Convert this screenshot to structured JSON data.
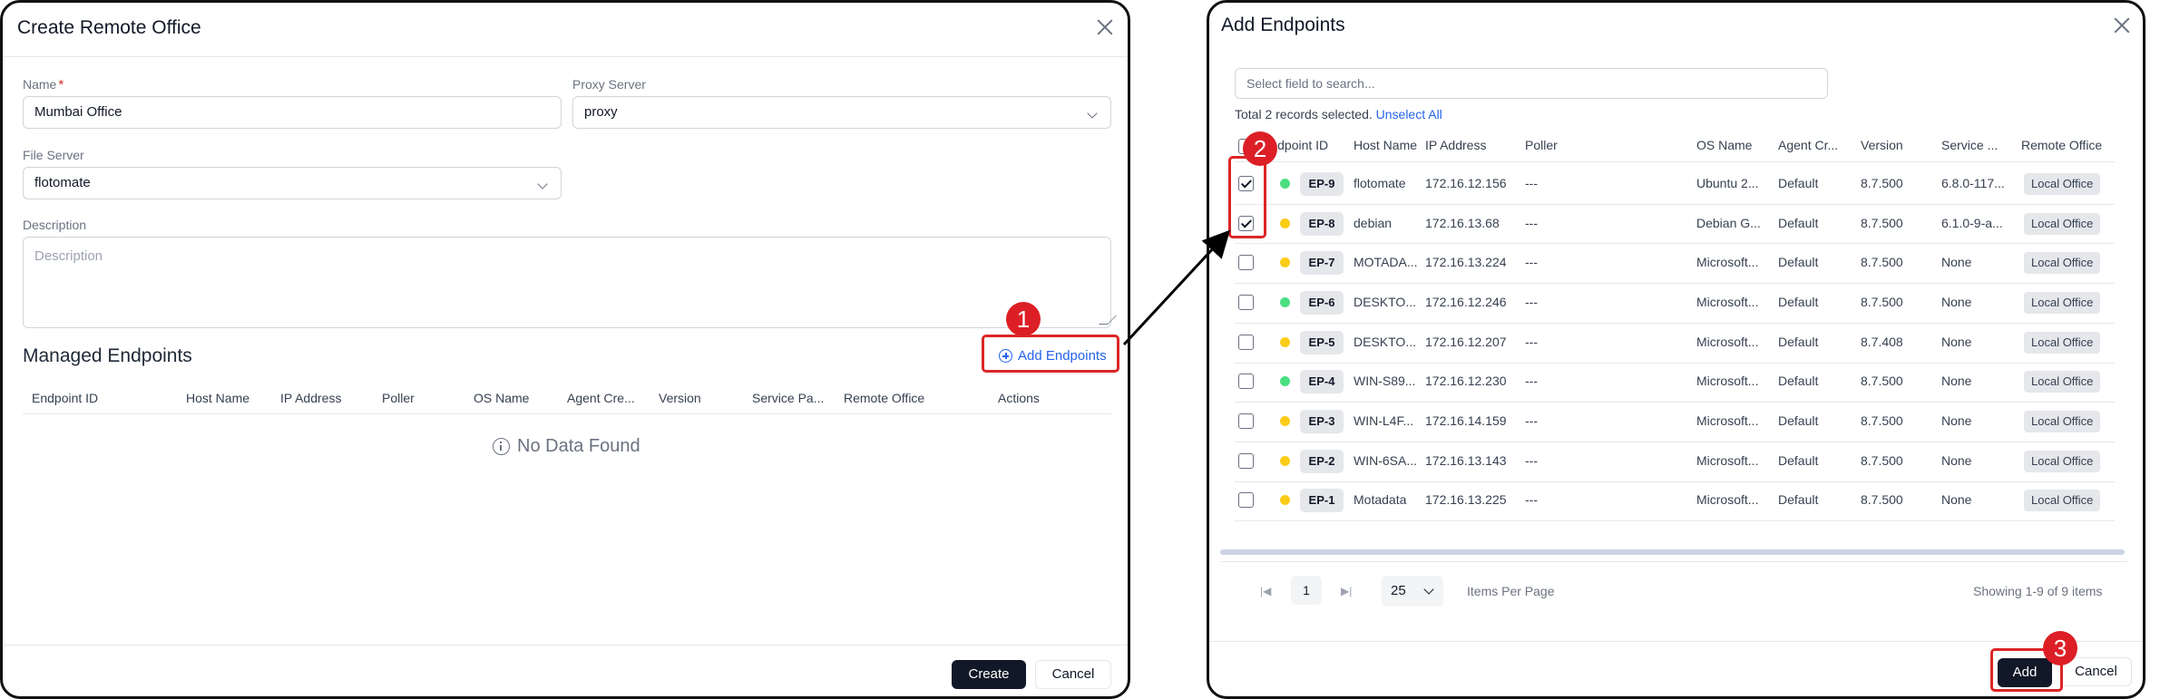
{
  "left": {
    "title": "Create Remote Office",
    "name_label": "Name",
    "required_mark": "*",
    "name_value": "Mumbai Office",
    "proxy_label": "Proxy Server",
    "proxy_value": "proxy",
    "file_label": "File Server",
    "file_value": "flotomate",
    "desc_label": "Description",
    "desc_placeholder": "Description",
    "managed_title": "Managed Endpoints",
    "add_endpoints": "Add Endpoints",
    "columns": [
      "Endpoint ID",
      "Host Name",
      "IP Address",
      "Poller",
      "OS Name",
      "Agent Cre...",
      "Version",
      "Service Pa...",
      "Remote Office",
      "Actions"
    ],
    "no_data": "No Data Found",
    "create": "Create",
    "cancel": "Cancel"
  },
  "right": {
    "title": "Add Endpoints",
    "search_placeholder": "Select field to search...",
    "selected_text": "Total 2 records selected.",
    "unselect_all": "Unselect All",
    "columns": [
      "Endpoint ID",
      "Host Name",
      "IP Address",
      "Poller",
      "OS Name",
      "Agent Cr...",
      "Version",
      "Service ...",
      "Remote Office"
    ],
    "rows": [
      {
        "checked": true,
        "status": "#4ade80",
        "id": "EP-9",
        "host": "flotomate",
        "ip": "172.16.12.156",
        "poller": "---",
        "os": "Ubuntu 2...",
        "agent": "Default",
        "version": "8.7.500",
        "service": "6.8.0-117...",
        "office": "Local Office"
      },
      {
        "checked": true,
        "status": "#facc15",
        "id": "EP-8",
        "host": "debian",
        "ip": "172.16.13.68",
        "poller": "---",
        "os": "Debian G...",
        "agent": "Default",
        "version": "8.7.500",
        "service": "6.1.0-9-a...",
        "office": "Local Office"
      },
      {
        "checked": false,
        "status": "#facc15",
        "id": "EP-7",
        "host": "MOTADA...",
        "ip": "172.16.13.224",
        "poller": "---",
        "os": "Microsoft...",
        "agent": "Default",
        "version": "8.7.500",
        "service": "None",
        "office": "Local Office"
      },
      {
        "checked": false,
        "status": "#4ade80",
        "id": "EP-6",
        "host": "DESKTO...",
        "ip": "172.16.12.246",
        "poller": "---",
        "os": "Microsoft...",
        "agent": "Default",
        "version": "8.7.500",
        "service": "None",
        "office": "Local Office"
      },
      {
        "checked": false,
        "status": "#facc15",
        "id": "EP-5",
        "host": "DESKTO...",
        "ip": "172.16.12.207",
        "poller": "---",
        "os": "Microsoft...",
        "agent": "Default",
        "version": "8.7.408",
        "service": "None",
        "office": "Local Office"
      },
      {
        "checked": false,
        "status": "#4ade80",
        "id": "EP-4",
        "host": "WIN-S89...",
        "ip": "172.16.12.230",
        "poller": "---",
        "os": "Microsoft...",
        "agent": "Default",
        "version": "8.7.500",
        "service": "None",
        "office": "Local Office"
      },
      {
        "checked": false,
        "status": "#facc15",
        "id": "EP-3",
        "host": "WIN-L4F...",
        "ip": "172.16.14.159",
        "poller": "---",
        "os": "Microsoft...",
        "agent": "Default",
        "version": "8.7.500",
        "service": "None",
        "office": "Local Office"
      },
      {
        "checked": false,
        "status": "#facc15",
        "id": "EP-2",
        "host": "WIN-6SA...",
        "ip": "172.16.13.143",
        "poller": "---",
        "os": "Microsoft...",
        "agent": "Default",
        "version": "8.7.500",
        "service": "None",
        "office": "Local Office"
      },
      {
        "checked": false,
        "status": "#facc15",
        "id": "EP-1",
        "host": "Motadata",
        "ip": "172.16.13.225",
        "poller": "---",
        "os": "Microsoft...",
        "agent": "Default",
        "version": "8.7.500",
        "service": "None",
        "office": "Local Office"
      }
    ],
    "page_first": "|◀",
    "page_last": "▶|",
    "page": "1",
    "per_page": "25",
    "items_per_page": "Items Per Page",
    "showing": "Showing 1-9 of 9 items",
    "add": "Add",
    "cancel": "Cancel"
  },
  "annotations": {
    "step1": "1",
    "step2": "2",
    "step3": "3",
    "color": "#dc2626"
  }
}
